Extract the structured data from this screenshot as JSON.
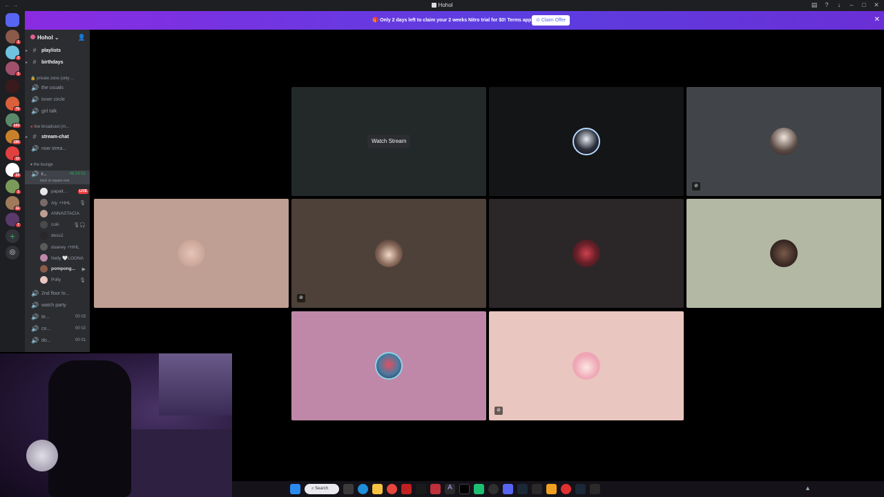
{
  "window": {
    "title": "Hohol"
  },
  "banner": {
    "message": "Only 2 days left to claim your 2 weeks Nitro trial for $0! Terms apply.",
    "claim_label": "Claim Offer",
    "close_icon": "close-icon"
  },
  "server": {
    "name": "Hohol"
  },
  "rail": {
    "badges": [
      "1",
      "2",
      "1",
      "76",
      "143",
      "186",
      "12",
      "24",
      "1",
      "11",
      "7"
    ]
  },
  "channels": {
    "text_top": [
      {
        "label": "playlists",
        "icon": "hash-icon"
      },
      {
        "label": "birthdays",
        "icon": "hash-icon"
      }
    ],
    "cat_private": "private zone (only ...",
    "private": [
      {
        "label": "the usuals"
      },
      {
        "label": "inner circle"
      },
      {
        "label": "girl talk"
      }
    ],
    "cat_broadcast": "live broadcast (m...",
    "broadcast": [
      {
        "label": "stream-chat",
        "icon": "hash-icon"
      },
      {
        "label": "now strea...",
        "icon": "speaker-icon"
      }
    ],
    "cat_lounge": "the lounge",
    "lounge_active": {
      "label": "r...",
      "timer": "46:24:51",
      "subtitle": "back to square one"
    },
    "voice_users": [
      {
        "name": "papalt...",
        "live": "LIVE"
      },
      {
        "name": "Aly ⚡HHL"
      },
      {
        "name": "ANNASTACIA"
      },
      {
        "name": "cuki"
      },
      {
        "name": "dess2."
      },
      {
        "name": "duaney ⚡HHL"
      },
      {
        "name": "Nelly 🤍LOONA"
      },
      {
        "name": "pompong..."
      },
      {
        "name": "Polly"
      }
    ],
    "voice_bottom": [
      {
        "label": "2nd floor lo...",
        "count": ""
      },
      {
        "label": "watch party",
        "count": ""
      },
      {
        "label": "te...",
        "count": "00 03"
      },
      {
        "label": "co...",
        "count": "00 02"
      },
      {
        "label": "do...",
        "count": "00 01"
      }
    ]
  },
  "grid": {
    "watch_label": "Watch Stream"
  },
  "colors": {
    "tile_pink": "#c088a8",
    "tile_peach": "#e9c6bf",
    "tile_sage": "#b3b8a4",
    "tile_rose": "#bf9e93",
    "tile_brown": "#4d4139",
    "tile_dark": "#2b2729",
    "tile_slate": "#414549",
    "tile_teal": "#232828"
  },
  "taskbar": {
    "search_label": "Search"
  }
}
